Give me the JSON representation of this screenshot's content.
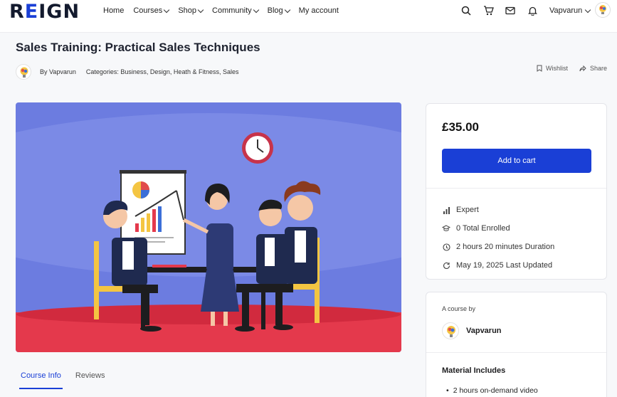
{
  "header": {
    "logo": "REIGN",
    "nav": [
      "Home",
      "Courses",
      "Shop",
      "Community",
      "Blog",
      "My account"
    ],
    "nav_dropdown": [
      false,
      true,
      true,
      true,
      true,
      false
    ],
    "username": "Vapvarun",
    "icons": [
      "search-icon",
      "cart-icon",
      "mail-icon",
      "bell-icon"
    ]
  },
  "course": {
    "title": "Sales Training: Practical Sales Techniques",
    "by": "By Vapvarun",
    "categories": "Categories: Business, Design, Heath & Fitness, Sales",
    "wishlist": "Wishlist",
    "share": "Share"
  },
  "tabs": [
    "Course Info",
    "Reviews"
  ],
  "price_card": {
    "price": "£35.00",
    "button": "Add to cart",
    "level": "Expert",
    "enrolled": "0 Total Enrolled",
    "duration": "2 hours  20 minutes  Duration",
    "updated": "May 19, 2025 Last Updated"
  },
  "author_card": {
    "label": "A course by",
    "name": "Vapvarun",
    "material_title": "Material Includes",
    "material_item": "2 hours on-demand video"
  },
  "colors": {
    "accent": "#1a3fd6",
    "hero_bg": "#6c7ce0",
    "floor": "#e4394c"
  }
}
